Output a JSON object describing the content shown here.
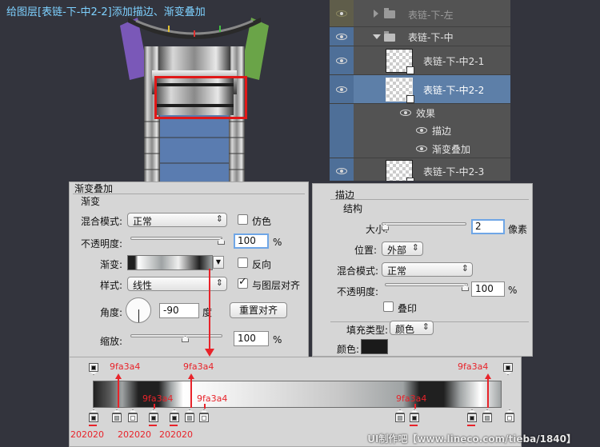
{
  "title": "给图层[表链-下-中2-2]添加描边、渐变叠加",
  "layers": {
    "rows": [
      {
        "name": "表链-下-左"
      },
      {
        "name": "表链-下-中"
      },
      {
        "name": "表链-下-中2-1"
      },
      {
        "name": "表链-下-中2-2"
      },
      {
        "name": "效果"
      },
      {
        "name": "描边"
      },
      {
        "name": "渐变叠加"
      },
      {
        "name": "表链-下-中2-3"
      }
    ]
  },
  "gradient_overlay": {
    "panel_title": "渐变叠加",
    "section_title": "渐变",
    "blend_mode_label": "混合模式:",
    "blend_mode_value": "正常",
    "dither_label": "仿色",
    "opacity_label": "不透明度:",
    "opacity_value": "100",
    "percent": "%",
    "gradient_label": "渐变:",
    "reverse_label": "反向",
    "style_label": "样式:",
    "style_value": "线性",
    "align_label": "与图层对齐",
    "angle_label": "角度:",
    "angle_value": "-90",
    "degree_unit": "度",
    "reset_align_label": "重置对齐",
    "scale_label": "缩放:",
    "scale_value": "100",
    "scale_percent": "%"
  },
  "stroke": {
    "panel_title": "描边",
    "section_title": "结构",
    "size_label": "大小:",
    "size_value": "2",
    "size_unit": "像素",
    "position_label": "位置:",
    "position_value": "外部",
    "blend_mode_label": "混合模式:",
    "blend_mode_value": "正常",
    "opacity_label": "不透明度:",
    "opacity_value": "100",
    "percent": "%",
    "overprint_label": "叠印",
    "fill_type_label": "填充类型:",
    "fill_type_value": "颜色",
    "color_label": "颜色:"
  },
  "gradient_editor": {
    "top_labels": [
      "9fa3a4",
      "9fa3a4",
      "9fa3a4"
    ],
    "mid_labels": [
      "9fa3a4",
      "9fa3a4",
      "9fa3a4"
    ],
    "bottom_labels": [
      "202020",
      "202020",
      "202020"
    ]
  },
  "colors": {
    "dark_stop": "#202020",
    "gray_stop": "#9fa3a4",
    "selected_layer": "#5d7fa8",
    "annotation": "#e8232a"
  },
  "watermark": "UI制作吧【www.lineco.com/tieba/1840】"
}
